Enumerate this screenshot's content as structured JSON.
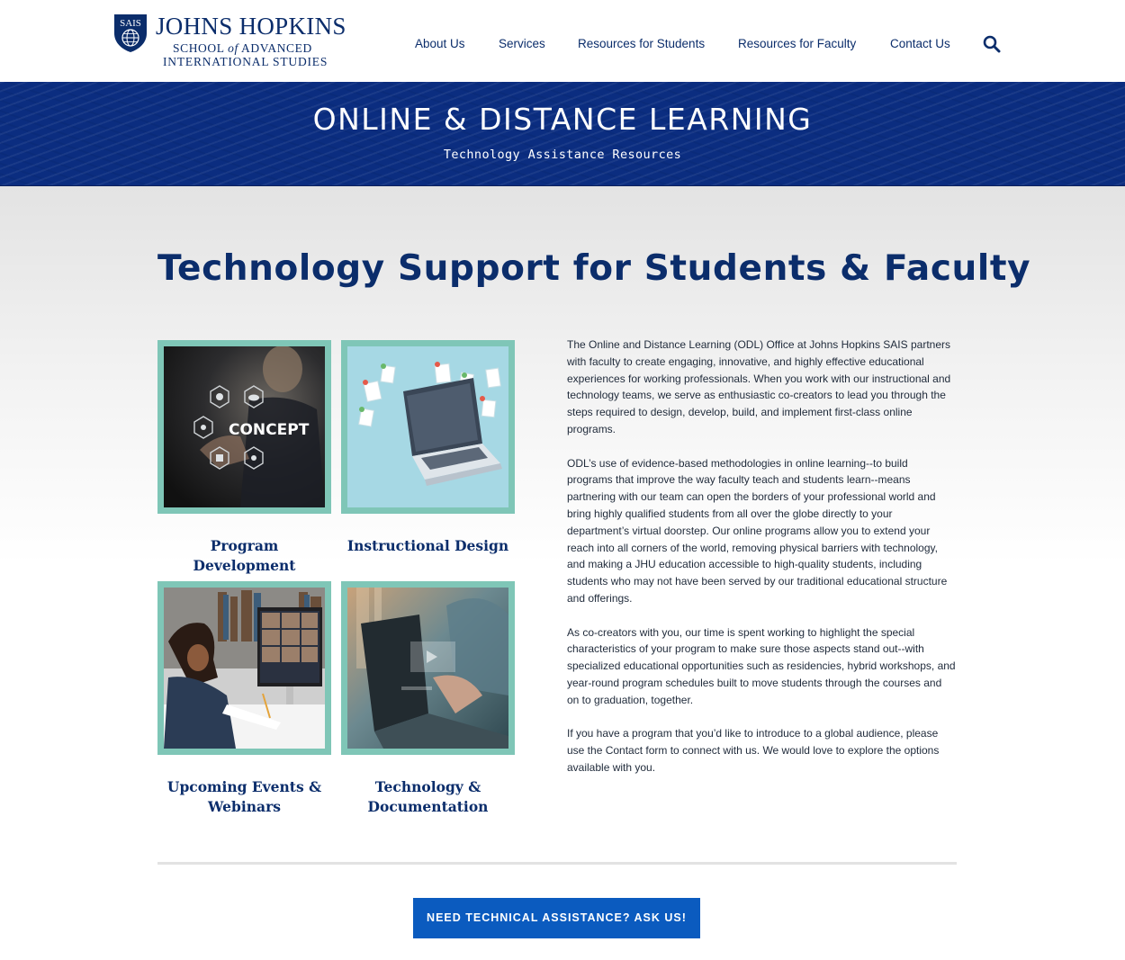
{
  "header": {
    "logo": {
      "badge": "SAIS",
      "name": "JOHNS HOPKINS",
      "line1_a": "SCHOOL",
      "line1_b": "of",
      "line1_c": "ADVANCED",
      "line2": "INTERNATIONAL STUDIES"
    },
    "nav": [
      {
        "label": "About Us"
      },
      {
        "label": "Services"
      },
      {
        "label": "Resources for Students"
      },
      {
        "label": "Resources for Faculty"
      },
      {
        "label": "Contact Us"
      }
    ],
    "search_icon": "search-icon"
  },
  "banner": {
    "title": "ONLINE & DISTANCE LEARNING",
    "subtitle": "Technology Assistance Resources"
  },
  "main": {
    "title": "Technology Support for Students & Faculty",
    "tiles": [
      {
        "label": "Program Development",
        "image": "concept-hexagon-icons-image",
        "image_text": "CONCEPT"
      },
      {
        "label": "Instructional Design",
        "image": "laptop-documents-illustration"
      },
      {
        "label": "Upcoming Events & Webinars",
        "image": "student-video-call-photo"
      },
      {
        "label": "Technology & Documentation",
        "image": "laptop-typing-photo"
      }
    ],
    "paragraphs": [
      "The Online and Distance Learning (ODL) Office at Johns Hopkins SAIS partners with faculty to create engaging, innovative, and highly effective educational experiences for working professionals. When you work with our instructional and technology teams, we serve as enthusiastic co-creators to lead you through the steps required to design, develop, build, and implement first-class online programs.",
      "ODL’s use of evidence-based methodologies in online learning--to build programs that improve the way faculty teach and students learn--means partnering with our team can open the borders of your professional world and bring highly qualified students from all over the globe directly to your department’s virtual doorstep. Our online programs allow you to extend your reach into all corners of the world, removing physical barriers with technology, and making a JHU education accessible to high-quality students, including students who may not have been served by our traditional educational structure and offerings.",
      "As co-creators with you, our time is spent working to highlight the special characteristics of your program to make sure those aspects stand out--with specialized educational opportunities such as residencies, hybrid workshops, and year-round program schedules built to move students through the courses and on to graduation, together.",
      "If you have a program that you’d like to introduce to a global audience, please use the Contact form to connect with us. We would love to explore the options available with you."
    ],
    "cta": "NEED TECHNICAL ASSISTANCE? ASK US!"
  },
  "colors": {
    "navy": "#0b2d6b",
    "banner": "#0b2d80",
    "tile_border": "#7fc6b7",
    "cta": "#0b5bbf"
  }
}
